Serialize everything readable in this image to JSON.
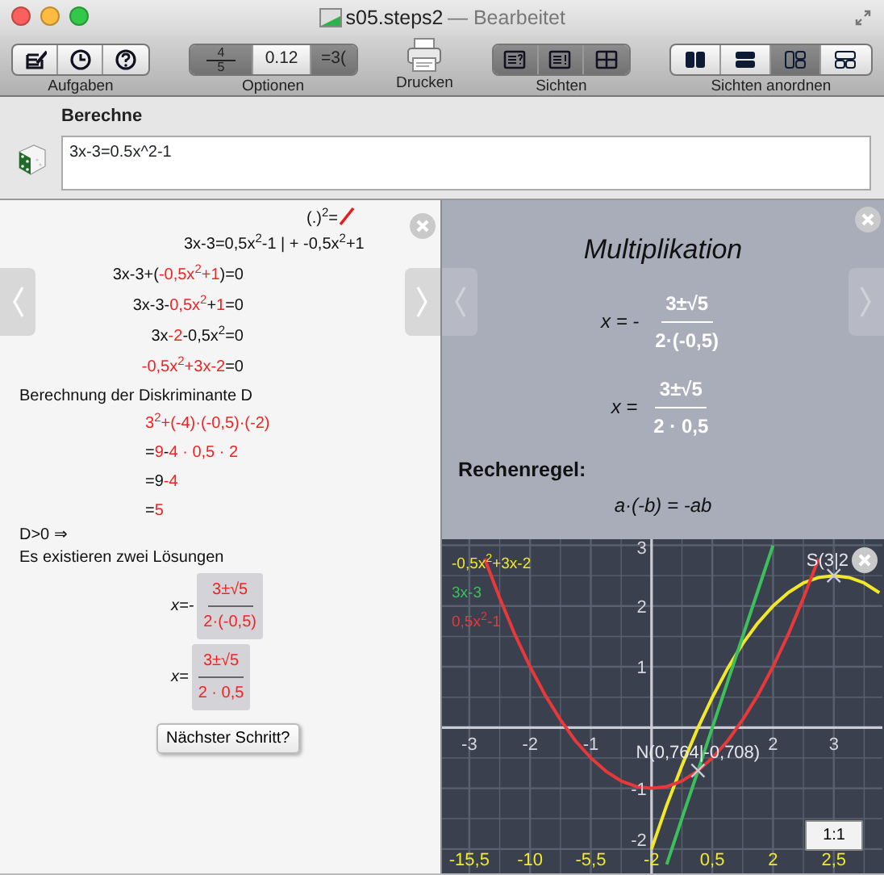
{
  "window": {
    "title": "s05.steps2",
    "status": "— Bearbeitet"
  },
  "toolbar": [
    {
      "label": "Aufgaben",
      "kind": "icons",
      "buttons": [
        {
          "selected": false
        },
        {
          "selected": false
        },
        {
          "selected": false
        }
      ]
    },
    {
      "label": "Optionen",
      "kind": "options",
      "buttons": [
        {
          "numerator": "4",
          "denominator": "5",
          "selected": true
        },
        {
          "text": "0.12",
          "selected": false
        },
        {
          "text": "=3(",
          "selected": true
        }
      ]
    },
    {
      "label": "Drucken",
      "kind": "print"
    },
    {
      "label": "Sichten",
      "kind": "views",
      "buttons": [
        {
          "selected": true
        },
        {
          "selected": true
        },
        {
          "selected": true
        }
      ]
    },
    {
      "label": "Sichten anordnen",
      "kind": "arrange",
      "buttons": [
        {
          "selected": false
        },
        {
          "selected": false
        },
        {
          "selected": true
        },
        {
          "selected": false
        }
      ]
    }
  ],
  "task": {
    "label": "Berechne",
    "value": "3x-3=0.5x^2-1"
  },
  "steps_panel": {
    "rule_hint": "(.)$^{2}$=",
    "equation": "3x-3=0,5x$^{2}$-1 | + -0,5x$^{2}$+1",
    "steps": [
      [
        {
          "text": "3x-3+(",
          "highlighted": false
        },
        {
          "text": " -0,5x$^{2}$+1",
          "highlighted": true
        },
        {
          "text": " )=0",
          "highlighted": false
        }
      ],
      [
        {
          "text": "3x-3-",
          "highlighted": false
        },
        {
          "text": " 0,5x$^{2}$",
          "highlighted": true
        },
        {
          "text": " + ",
          "highlighted": false
        },
        {
          "text": "1",
          "highlighted": true
        },
        {
          "text": " =0",
          "highlighted": false
        }
      ],
      [
        {
          "text": "3x",
          "highlighted": false
        },
        {
          "text": "-2",
          "highlighted": true
        },
        {
          "text": " -0,5x$^{2}$=0",
          "highlighted": false
        }
      ],
      [
        {
          "text": "-0,5x$^{2}$+3x-2",
          "highlighted": true
        },
        {
          "text": " =0",
          "highlighted": false
        }
      ]
    ],
    "section_title": "Berechnung der Diskriminante D",
    "discriminant_steps": [
      [
        {
          "text": "3$^{2}$+(-4)·(-0,5)·(-2)",
          "highlighted": true
        }
      ],
      [
        {
          "text": "= ",
          "highlighted": false
        },
        {
          "text": "9",
          "highlighted": true
        },
        {
          "text": " - ",
          "highlighted": false
        },
        {
          "text": "4 · 0,5 · 2",
          "highlighted": true
        }
      ],
      [
        {
          "text": "=9 ",
          "highlighted": false
        },
        {
          "text": "-4",
          "highlighted": true
        }
      ],
      [
        {
          "text": "= ",
          "highlighted": false
        },
        {
          "text": "5",
          "highlighted": true
        }
      ]
    ],
    "conclusion": "D>0 ⇒",
    "result_text": "Es existieren zwei Lösungen",
    "solutions": [
      {
        "lhs": "x=-",
        "numerator": "3±√5",
        "denominator": "2·(-0,5)"
      },
      {
        "lhs": "x=",
        "numerator": "3±√5",
        "denominator": "2 · 0,5"
      }
    ],
    "next_button": "Nächster Schritt?"
  },
  "rule_panel": {
    "title": "Multiplikation",
    "fractions": [
      {
        "lhs": "x = -",
        "numerator": "3±√5",
        "denominator": "2·(-0,5)"
      },
      {
        "lhs": "x =",
        "numerator": "3±√5",
        "denominator": "2 · 0,5"
      }
    ],
    "rule_title": "Rechenregel:",
    "rule": "a·(-b) = -ab"
  },
  "graph": {
    "zoom_button": "1:1",
    "bottom_axis_labels": [
      "-15,5",
      "-10",
      "-5,5",
      "-2",
      "0,5",
      "2",
      "2,5"
    ],
    "chart_data": {
      "type": "line",
      "grid": true,
      "x": [
        -2.75,
        -2.5,
        -2.25,
        -2,
        -1.75,
        -1.5,
        -1.25,
        -1,
        -0.75,
        -0.5,
        -0.25,
        0,
        0.25,
        0.5,
        0.75,
        1,
        1.25,
        1.5,
        1.75,
        2,
        2.25,
        2.5,
        2.75,
        3,
        3.25,
        3.5,
        3.75
      ],
      "series": [
        {
          "name": "-0,5x$^{2}$+3x-2",
          "color": "#f2e82a",
          "values": [
            null,
            null,
            null,
            null,
            null,
            null,
            null,
            null,
            null,
            null,
            null,
            -2,
            -1.28,
            -0.63,
            -0.03,
            0.5,
            0.97,
            1.38,
            1.72,
            2,
            2.22,
            2.38,
            2.47,
            2.5,
            2.47,
            2.38,
            2.22
          ]
        },
        {
          "name": "3x-3",
          "color": "#3dbf5c",
          "values": [
            null,
            null,
            null,
            null,
            null,
            null,
            null,
            null,
            null,
            null,
            null,
            null,
            -2.25,
            -1.5,
            -0.75,
            0,
            0.75,
            1.5,
            2.25,
            3,
            null,
            null,
            null,
            null,
            null,
            null,
            null
          ]
        },
        {
          "name": "0,5x$^{2}$-1",
          "color": "#e8383a",
          "values": [
            2.78,
            2.13,
            1.53,
            1,
            0.53,
            0.13,
            -0.22,
            -0.5,
            -0.72,
            -0.88,
            -0.97,
            -1,
            -0.97,
            -0.88,
            -0.72,
            -0.5,
            -0.22,
            0.13,
            0.53,
            1,
            1.53,
            2.13,
            2.78,
            null,
            null,
            null,
            null
          ]
        }
      ],
      "xlim": [
        -3.45,
        3.8
      ],
      "ylim": [
        -2.4,
        3.1
      ],
      "xticks": [
        -3,
        -2,
        -1,
        2,
        3
      ],
      "yticks": [
        -2,
        -1,
        1,
        2,
        3
      ],
      "annotations": [
        {
          "text": "N(0,764|-0,708)",
          "x": 0.764,
          "y": -0.708
        },
        {
          "text": "S(3|2",
          "x": 3,
          "y": 2.5
        }
      ]
    }
  }
}
